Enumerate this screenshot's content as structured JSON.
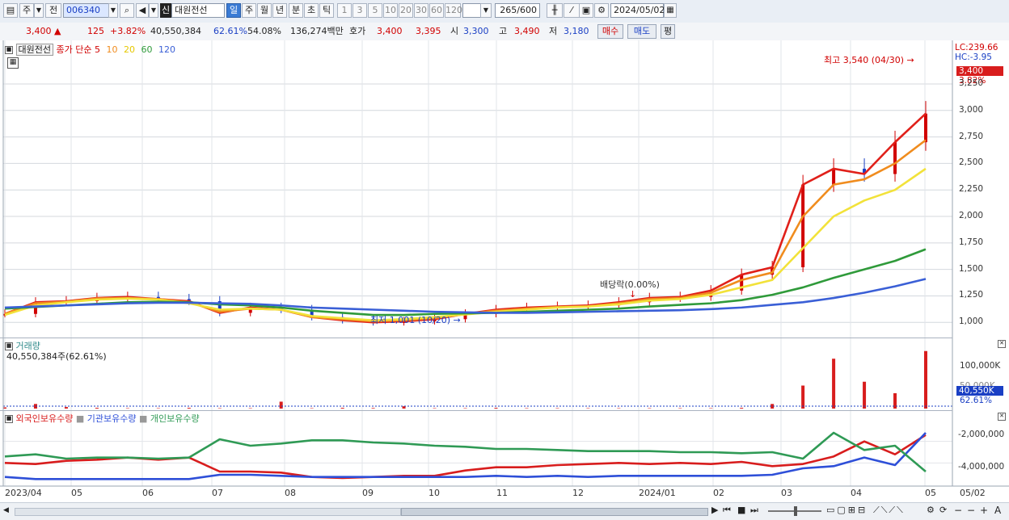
{
  "toolbar": {
    "type_label": "주",
    "prev_label": "전",
    "code": "006340",
    "market_badge": "신",
    "stock_name": "대원전선",
    "periods": [
      "일",
      "주",
      "월",
      "년",
      "분",
      "초",
      "틱"
    ],
    "active_period": "일",
    "intervals": [
      "1",
      "3",
      "5",
      "10",
      "20",
      "30",
      "60",
      "120"
    ],
    "count": "265",
    "count_total": "/600",
    "date": "2024/05/02"
  },
  "quote": {
    "price": "3,400",
    "change": "125",
    "change_pct": "+3.82%",
    "volume": "40,550,384",
    "turnover_pct": "62.61%",
    "ratio": "54.08%",
    "amount": "136,274백만",
    "hoga_label": "호가",
    "ask": "3,400",
    "bid": "3,395",
    "open_label": "시",
    "open": "3,300",
    "high_label": "고",
    "high": "3,490",
    "low_label": "저",
    "low": "3,180",
    "buy_label": "매수",
    "sell_label": "매도",
    "flat_label": "평"
  },
  "price_panel": {
    "name": "대원전선",
    "ma_title": "종가 단순",
    "ma_periods": [
      "5",
      "10",
      "20",
      "60",
      "120"
    ],
    "lc_label": "LC:239.66",
    "hc_label": "HC:-3.95",
    "current_tag": "3,400",
    "current_pct": "3.82%",
    "high_annotation": "최고 3,540 (04/30)",
    "low_annotation": "최저 1,001 (10/20)",
    "dividend_annotation": "배당락(0.00%)"
  },
  "volume_panel": {
    "title": "거래량",
    "value_text": "40,550,384주(62.61%)",
    "tag_value": "40,550K",
    "tag_pct": "62.61%",
    "tick_100k": "100,000K",
    "tick_50k": "50,000K"
  },
  "holdings_panel": {
    "legend": [
      "외국인보유수량",
      "기관보유수량",
      "개인보유수량"
    ],
    "ticks": [
      "-2,000,000",
      "-4,000,000"
    ]
  },
  "colors": {
    "up": "#d10000",
    "down": "#1a3fc4",
    "ma5": "#e0201a",
    "ma10": "#f08c1e",
    "ma20": "#f2e23a",
    "ma60": "#2f9a3a",
    "ma120": "#3a5fd6",
    "foreign": "#d81d1d",
    "institution": "#2e4fd8",
    "individual": "#2f9a55",
    "volume_bar": "#d81d1d"
  },
  "chart_data": {
    "type": "candlestick",
    "y_ticks": [
      1000,
      1250,
      1500,
      1750,
      2000,
      2250,
      2500,
      2750,
      3000,
      3250
    ],
    "ylim": [
      880,
      3600
    ],
    "x_labels": [
      "2023/04",
      "05",
      "06",
      "07",
      "08",
      "09",
      "10",
      "11",
      "12",
      "2024/01",
      "02",
      "03",
      "04",
      "05",
      "05/02"
    ],
    "series": [
      {
        "name": "5",
        "values": [
          1080,
          1190,
          1200,
          1230,
          1240,
          1220,
          1200,
          1090,
          1140,
          1120,
          1050,
          1020,
          1000,
          1010,
          1030,
          1080,
          1120,
          1140,
          1150,
          1160,
          1190,
          1230,
          1240,
          1300,
          1450,
          1520,
          2300,
          2450,
          2400,
          2700,
          2970
        ]
      },
      {
        "name": "10",
        "values": [
          1080,
          1180,
          1195,
          1225,
          1230,
          1220,
          1190,
          1100,
          1130,
          1120,
          1050,
          1030,
          1010,
          1020,
          1040,
          1080,
          1110,
          1130,
          1145,
          1150,
          1180,
          1220,
          1230,
          1280,
          1400,
          1470,
          2000,
          2300,
          2350,
          2500,
          2720
        ]
      },
      {
        "name": "20",
        "values": [
          1070,
          1160,
          1190,
          1215,
          1225,
          1215,
          1180,
          1120,
          1130,
          1120,
          1060,
          1040,
          1020,
          1030,
          1050,
          1075,
          1100,
          1120,
          1140,
          1150,
          1170,
          1205,
          1220,
          1260,
          1330,
          1400,
          1700,
          2000,
          2150,
          2250,
          2450
        ]
      },
      {
        "name": "60",
        "values": [
          1130,
          1145,
          1160,
          1175,
          1190,
          1195,
          1190,
          1170,
          1160,
          1140,
          1110,
          1090,
          1070,
          1070,
          1080,
          1085,
          1090,
          1100,
          1110,
          1120,
          1130,
          1150,
          1165,
          1180,
          1210,
          1260,
          1330,
          1420,
          1500,
          1580,
          1690
        ]
      },
      {
        "name": "120",
        "values": [
          1140,
          1150,
          1160,
          1170,
          1180,
          1185,
          1185,
          1180,
          1175,
          1160,
          1140,
          1130,
          1120,
          1110,
          1100,
          1095,
          1090,
          1090,
          1095,
          1100,
          1105,
          1110,
          1115,
          1125,
          1140,
          1165,
          1190,
          1230,
          1280,
          1340,
          1410
        ]
      }
    ],
    "holdings": [
      {
        "name": "외국인보유수량",
        "values": [
          -4000000,
          -4100000,
          -3800000,
          -3700000,
          -3500000,
          -3700000,
          -3500000,
          -4800000,
          -4800000,
          -4900000,
          -5300000,
          -5400000,
          -5300000,
          -5200000,
          -5200000,
          -4700000,
          -4400000,
          -4400000,
          -4200000,
          -4100000,
          -4000000,
          -4100000,
          -4000000,
          -4100000,
          -3900000,
          -4300000,
          -4100000,
          -3400000,
          -2000000,
          -3200000,
          -1400000
        ]
      },
      {
        "name": "기관보유수량",
        "values": [
          -5300000,
          -5500000,
          -5500000,
          -5500000,
          -5500000,
          -5500000,
          -5500000,
          -5100000,
          -5100000,
          -5200000,
          -5300000,
          -5300000,
          -5300000,
          -5300000,
          -5300000,
          -5300000,
          -5200000,
          -5300000,
          -5200000,
          -5300000,
          -5200000,
          -5200000,
          -5200000,
          -5200000,
          -5200000,
          -5100000,
          -4500000,
          -4300000,
          -3500000,
          -4200000,
          -1200000
        ]
      },
      {
        "name": "개인보유수량",
        "values": [
          -3400000,
          -3200000,
          -3600000,
          -3500000,
          -3500000,
          -3600000,
          -3500000,
          -1800000,
          -2400000,
          -2200000,
          -1900000,
          -1900000,
          -2100000,
          -2200000,
          -2400000,
          -2500000,
          -2700000,
          -2700000,
          -2800000,
          -2900000,
          -2900000,
          -2900000,
          -3000000,
          -3000000,
          -3100000,
          -3000000,
          -3600000,
          -1200000,
          -2800000,
          -2400000,
          -4800000
        ]
      }
    ],
    "volume_k": [
      3000,
      12000,
      4000,
      2000,
      1000,
      1000,
      2000,
      1000,
      1000,
      18000,
      1000,
      2000,
      1500,
      6000,
      1000,
      1000,
      2000,
      1000,
      1000,
      1000,
      1000,
      1000,
      1000,
      1000,
      2000,
      12000,
      60000,
      130000,
      70000,
      40000,
      150000
    ]
  }
}
